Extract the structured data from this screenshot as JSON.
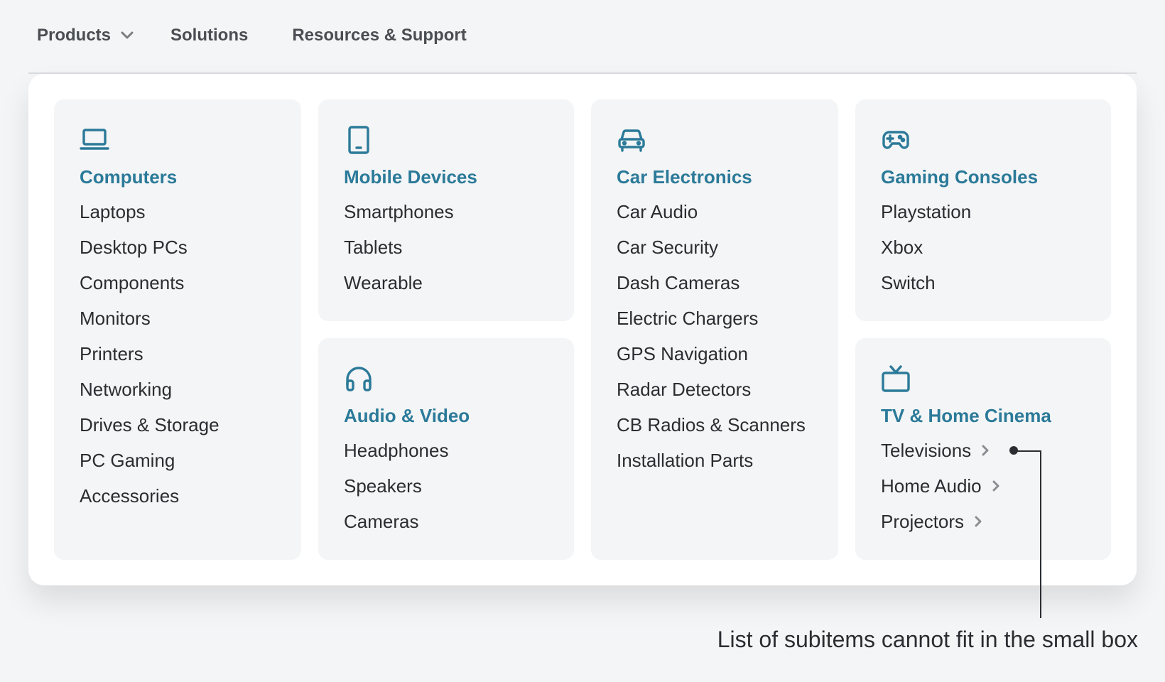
{
  "nav": {
    "items": [
      {
        "label": "Products"
      },
      {
        "label": "Solutions"
      },
      {
        "label": "Resources & Support"
      }
    ]
  },
  "menu": {
    "computers": {
      "icon": "laptop-icon",
      "title": "Computers",
      "items": [
        "Laptops",
        "Desktop PCs",
        "Components",
        "Monitors",
        "Printers",
        "Networking",
        "Drives & Storage",
        "PC Gaming",
        "Accessories"
      ]
    },
    "mobile": {
      "icon": "tablet-icon",
      "title": "Mobile Devices",
      "items": [
        "Smartphones",
        "Tablets",
        "Wearable"
      ]
    },
    "audio": {
      "icon": "headphones-icon",
      "title": "Audio & Video",
      "items": [
        "Headphones",
        "Speakers",
        "Cameras"
      ]
    },
    "car": {
      "icon": "car-icon",
      "title": "Car Electronics",
      "items": [
        "Car Audio",
        "Car Security",
        "Dash Cameras",
        "Electric Chargers",
        "GPS Navigation",
        "Radar Detectors",
        "CB Radios & Scanners",
        "Installation Parts"
      ]
    },
    "gaming": {
      "icon": "gamepad-icon",
      "title": "Gaming Consoles",
      "items": [
        "Playstation",
        "Xbox",
        "Switch"
      ]
    },
    "tv": {
      "icon": "tv-icon",
      "title": "TV & Home Cinema",
      "items": [
        "Televisions",
        "Home Audio",
        "Projectors"
      ]
    }
  },
  "annotation": {
    "text": "List of subitems cannot fit in the small box"
  },
  "colors": {
    "accent": "#2b7a99",
    "text": "#2a2d31",
    "card_bg": "#f4f5f6"
  }
}
